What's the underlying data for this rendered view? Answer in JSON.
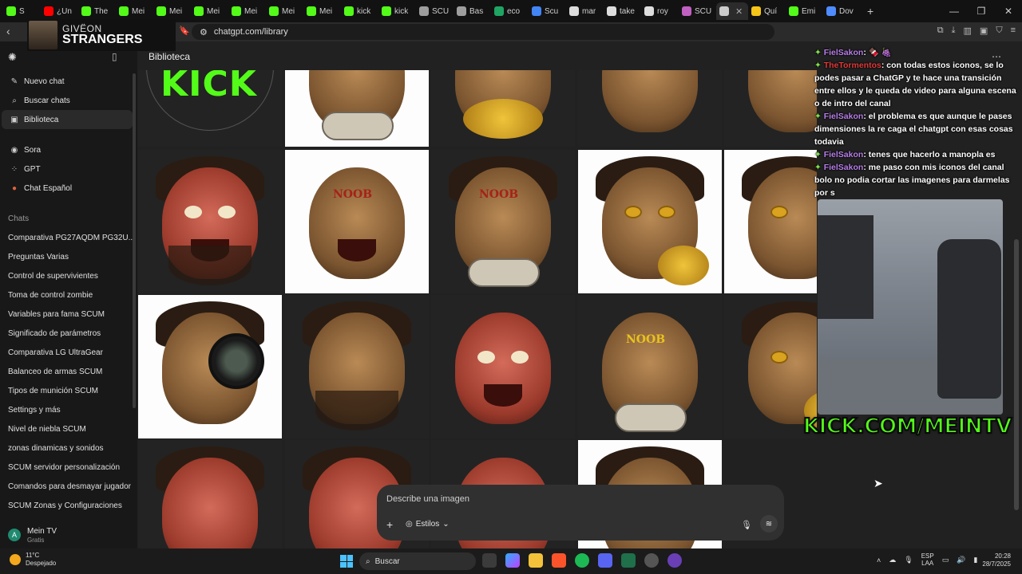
{
  "browser": {
    "tabs": [
      {
        "label": "S",
        "color": "#53fc18"
      },
      {
        "label": "¿Un",
        "color": "#ff0000"
      },
      {
        "label": "The",
        "color": "#53fc18"
      },
      {
        "label": "Mei",
        "color": "#53fc18"
      },
      {
        "label": "Mei",
        "color": "#53fc18"
      },
      {
        "label": "Mei",
        "color": "#53fc18"
      },
      {
        "label": "Mei",
        "color": "#53fc18"
      },
      {
        "label": "Mei",
        "color": "#53fc18"
      },
      {
        "label": "Mei",
        "color": "#53fc18"
      },
      {
        "label": "kick",
        "color": "#53fc18"
      },
      {
        "label": "kick",
        "color": "#53fc18"
      },
      {
        "label": "SCU",
        "color": "#9e9e9e"
      },
      {
        "label": "Bas",
        "color": "#9e9e9e"
      },
      {
        "label": "eco",
        "color": "#1fa463"
      },
      {
        "label": "Scu",
        "color": "#4285f4"
      },
      {
        "label": "mar",
        "color": "#dddddd"
      },
      {
        "label": "take",
        "color": "#dddddd"
      },
      {
        "label": "roy",
        "color": "#dddddd"
      },
      {
        "label": "SCU",
        "color": "#c060c0"
      },
      {
        "label": "",
        "color": "#cccccc",
        "active": true
      },
      {
        "label": "Quí",
        "color": "#f5c518"
      },
      {
        "label": "Emi",
        "color": "#53fc18"
      },
      {
        "label": "Dov",
        "color": "#4f8cff"
      }
    ],
    "url": "chatgpt.com/library",
    "notification_count": "1"
  },
  "streamer_tag": {
    "name": "GIVËON",
    "title": "STRANGERS"
  },
  "sidebar": {
    "nav": [
      {
        "label": "Nuevo chat",
        "icon": "edit-icon"
      },
      {
        "label": "Buscar chats",
        "icon": "search-icon"
      },
      {
        "label": "Biblioteca",
        "icon": "image-library-icon",
        "active": true
      }
    ],
    "apps": [
      {
        "label": "Sora",
        "icon": "sora-icon"
      },
      {
        "label": "GPT",
        "icon": "grid-icon"
      },
      {
        "label": "Chat Español",
        "icon": "flag-icon"
      }
    ],
    "chats_heading": "Chats",
    "chats": [
      "Comparativa PG27AQDM PG32U...",
      "Preguntas Varias",
      "Control de supervivientes",
      "Toma de control zombie",
      "Variables para fama SCUM",
      "Significado de parámetros",
      "Comparativa LG UltraGear",
      "Balanceo de armas SCUM",
      "Tipos de munición SCUM",
      "Settings y más",
      "Nivel de niebla SCUM",
      "zonas dinamicas y sonidos",
      "SCUM servidor personalización",
      "Comandos para desmayar jugador",
      "SCUM Zonas y Configuraciones"
    ],
    "user": {
      "initial": "A",
      "name": "Mein TV",
      "plan": "Gratis"
    }
  },
  "main": {
    "title": "Biblioteca",
    "gallery_text": {
      "kick_logo": "KICK",
      "noob": "NOOB"
    },
    "composer": {
      "placeholder": "Describe una imagen",
      "styles_label": "Estilos"
    }
  },
  "stream_chat": [
    {
      "user": "FielSakon",
      "user_color": "#b77ee8",
      "text": ": 🍫 🍇"
    },
    {
      "user": "TheTormentos",
      "user_color": "#e23a3a",
      "text": ": con todas estos iconos, se lo podes pasar a ChatGP y te hace una transición entre ellos y le queda de video para alguna escena o de intro del canal"
    },
    {
      "user": "FielSakon",
      "user_color": "#b77ee8",
      "text": ": el problema es que aunque le pases dimensiones la re caga el chatgpt con esas cosas todavia"
    },
    {
      "user": "FielSakon",
      "user_color": "#b77ee8",
      "text": ": tenes que hacerlo a manopla es"
    },
    {
      "user": "FielSakon",
      "user_color": "#b77ee8",
      "text": ": me paso con mis iconos del canal bolo no podia cortar las imagenes para darmelas por s"
    }
  ],
  "kick_banner": "KICK.COM/MEINTV",
  "taskbar": {
    "weather_temp": "11°C",
    "weather_desc": "Despejado",
    "search_label": "Buscar",
    "lang_top": "ESP",
    "lang_bottom": "LAA",
    "time": "20:28",
    "date": "28/7/2025"
  }
}
